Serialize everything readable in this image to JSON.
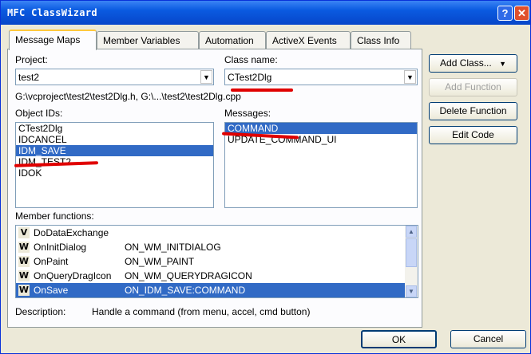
{
  "window": {
    "title": "MFC ClassWizard",
    "help_glyph": "?",
    "close_glyph": "✕"
  },
  "tabs": [
    {
      "label": "Message Maps",
      "active": true
    },
    {
      "label": "Member Variables",
      "active": false
    },
    {
      "label": "Automation",
      "active": false
    },
    {
      "label": "ActiveX Events",
      "active": false
    },
    {
      "label": "Class Info",
      "active": false
    }
  ],
  "project": {
    "label": "Project:",
    "value": "test2"
  },
  "class_name": {
    "label": "Class name:",
    "value": "CTest2Dlg"
  },
  "path": "G:\\vcproject\\test2\\test2Dlg.h, G:\\...\\test2\\test2Dlg.cpp",
  "object_ids": {
    "label": "Object IDs:",
    "items": [
      "CTest2Dlg",
      "IDCANCEL",
      "IDM_SAVE",
      "IDM_TEST2",
      "IDOK"
    ],
    "selected": "IDM_SAVE"
  },
  "messages": {
    "label": "Messages:",
    "items": [
      "COMMAND",
      "UPDATE_COMMAND_UI"
    ],
    "selected": "COMMAND"
  },
  "member_functions": {
    "label": "Member functions:",
    "rows": [
      {
        "type": "V",
        "function": "DoDataExchange",
        "message": ""
      },
      {
        "type": "W",
        "function": "OnInitDialog",
        "message": "ON_WM_INITDIALOG"
      },
      {
        "type": "W",
        "function": "OnPaint",
        "message": "ON_WM_PAINT"
      },
      {
        "type": "W",
        "function": "OnQueryDragIcon",
        "message": "ON_WM_QUERYDRAGICON"
      },
      {
        "type": "W",
        "function": "OnSave",
        "message": "ON_IDM_SAVE:COMMAND",
        "selected": true
      }
    ]
  },
  "description": {
    "label": "Description:",
    "text": "Handle a command (from menu, accel, cmd button)"
  },
  "buttons": {
    "add_class": "Add Class...",
    "add_class_arrow": "▼",
    "add_function": "Add Function",
    "delete_function": "Delete Function",
    "edit_code": "Edit Code",
    "ok": "OK",
    "cancel": "Cancel"
  },
  "colors": {
    "selection": "#316ac5",
    "annotation": "#e00000",
    "titlebar": "#0a5ae0"
  },
  "icons": {
    "dropdown": "chevron-down-icon",
    "scroll_up": "scroll-up-icon",
    "scroll_down": "scroll-down-icon"
  }
}
